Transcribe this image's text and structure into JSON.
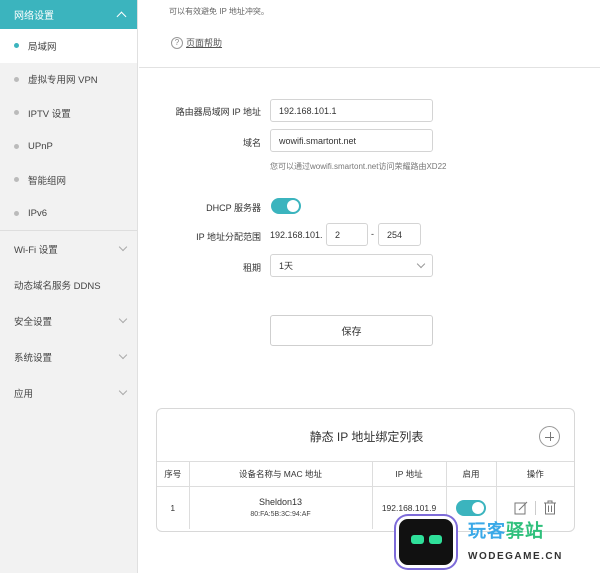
{
  "sidebar": {
    "group": {
      "label": "网络设置"
    },
    "subitems": [
      {
        "label": "局域网",
        "active": true
      },
      {
        "label": "虚拟专用网 VPN",
        "active": false
      },
      {
        "label": "IPTV 设置",
        "active": false
      },
      {
        "label": "UPnP",
        "active": false
      },
      {
        "label": "智能组网",
        "active": false
      },
      {
        "label": "IPv6",
        "active": false
      }
    ],
    "items": [
      {
        "label": "Wi-Fi 设置"
      },
      {
        "label": "动态域名服务 DDNS"
      },
      {
        "label": "安全设置"
      },
      {
        "label": "系统设置"
      },
      {
        "label": "应用"
      }
    ]
  },
  "main": {
    "top_note": "可以有效避免 IP 地址冲突。",
    "help": {
      "icon": "question-icon",
      "label": "页面帮助"
    },
    "form": {
      "router_ip_label": "路由器局域网 IP 地址",
      "router_ip_value": "192.168.101.1",
      "domain_label": "域名",
      "domain_value": "wowifi.smartont.net",
      "domain_hint": "您可以通过wowifi.smartont.net访问荣耀路由XD22",
      "dhcp_label": "DHCP 服务器",
      "dhcp_enabled": true,
      "range_label": "IP 地址分配范围",
      "range_prefix": "192.168.101.",
      "range_start": "2",
      "range_dash": "-",
      "range_end": "254",
      "lease_label": "租期",
      "lease_value": "1天",
      "save_label": "保存"
    },
    "static_table": {
      "title": "静态 IP 地址绑定列表",
      "headers": [
        "序号",
        "设备名称与 MAC 地址",
        "IP 地址",
        "启用",
        "操作"
      ],
      "rows": [
        {
          "index": "1",
          "name": "Sheldon13",
          "mac": "80:FA:5B:3C:94:AF",
          "ip": "192.168.101.9",
          "enabled": true
        }
      ]
    }
  },
  "watermark": {
    "text_a": "玩客",
    "text_b": "驿站",
    "sub": "WODEGAME.CN"
  },
  "colors": {
    "accent": "#3bb4be",
    "sidebar_bg": "#f2f2f2"
  }
}
